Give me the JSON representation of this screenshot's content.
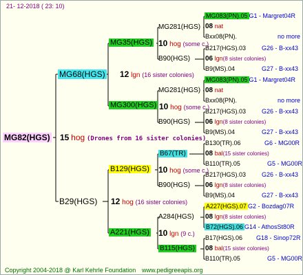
{
  "date": "21- 12-2018 ( 23: 10)",
  "copyright": "Copyright 2004-2018 @ Karl Kehrle Foundation",
  "website": "www.pedigreeapis.org",
  "root": {
    "code": "MG82(HGS)",
    "num": "15",
    "hog": "hog",
    "note": "(Drones from 16 sister colonies)"
  },
  "g1": [
    {
      "code": "MG68(HGS)",
      "num": "12",
      "hog": "lgn",
      "note": "(16 sister colonies)"
    },
    {
      "code": "B29(HGS)",
      "num": "12",
      "hog": "hog",
      "note": "(16 sister colonies)"
    }
  ],
  "g2": [
    {
      "code": "MG35(HGS)",
      "num": "10",
      "hog": "hog",
      "note": "(some c.)"
    },
    {
      "code": "MG300(HGS)",
      "num": "10",
      "hog": "hog",
      "note": "(some c.)"
    },
    {
      "code": "B129(HGS)",
      "num": "10",
      "hog": "hog",
      "note": "(some c.)"
    },
    {
      "code": "A221(HGS)",
      "num": "10",
      "hog": "lgn",
      "note": "(9 c.)"
    }
  ],
  "g3": [
    {
      "code": "MG281(HGS)"
    },
    {
      "code": "B90(HGS)"
    },
    {
      "code": "MG281(HGS)"
    },
    {
      "code": "B90(HGS)"
    },
    {
      "code": "B67(TR)"
    },
    {
      "code": "B90(HGS)"
    },
    {
      "code": "A284(HGS)"
    },
    {
      "code": "B115(HGS)"
    }
  ],
  "g4": [
    {
      "code": "MG083(PN).05",
      "ref": "G1 - Margret04R"
    },
    {
      "line": "08 nat",
      "num": "08",
      "hog": "nat",
      "note": ""
    },
    {
      "code": "Bxx08(PN).",
      "ref": "no more"
    },
    {
      "code": "B217(HGS).03",
      "ref": "G26 - B-xx43"
    },
    {
      "line": "06 lgn(8 sister colonies)",
      "num": "06",
      "hog": "lgn",
      "note": "(8 sister colonies)"
    },
    {
      "code": "B9(MS).04",
      "ref": "G27 - B-xx43"
    },
    {
      "code": "MG083(PN).05",
      "ref": "G1 - Margret04R"
    },
    {
      "line": "08 nat",
      "num": "08",
      "hog": "nat",
      "note": ""
    },
    {
      "code": "Bxx08(PN).",
      "ref": "no more"
    },
    {
      "code": "B217(HGS).03",
      "ref": "G26 - B-xx43"
    },
    {
      "line": "06 lgn(8 sister colonies)",
      "num": "06",
      "hog": "lgn",
      "note": "(8 sister colonies)"
    },
    {
      "code": "B9(MS).04",
      "ref": "G27 - B-xx43"
    },
    {
      "code": "B130(TR).06",
      "ref": "G6 - MG00R"
    },
    {
      "line": "08 bal(15 sister colonies)",
      "num": "08",
      "hog": "bal",
      "note": "(15 sister colonies)"
    },
    {
      "code": "B110(TR).05",
      "ref": "G5 - MG00R"
    },
    {
      "code": "B217(HGS).03",
      "ref": "G26 - B-xx43"
    },
    {
      "line": "06 lgn(8 sister colonies)",
      "num": "06",
      "hog": "lgn",
      "note": "(8 sister colonies)"
    },
    {
      "code": "B9(MS).04",
      "ref": "G27 - B-xx43"
    },
    {
      "code": "A227(HGS).07",
      "ref": "G2 - Bozdag07R"
    },
    {
      "line": "08 lgn(8 sister colonies)",
      "num": "08",
      "hog": "lgn",
      "note": "(8 sister colonies)"
    },
    {
      "code": "B72(HGS).06",
      "ref": "G14 - AthosSt80R"
    },
    {
      "code": "B17(HGS).06",
      "ref": "G18 - Sinop72R"
    },
    {
      "line": "08 bal(15 sister colonies)",
      "num": "08",
      "hog": "bal",
      "note": "(15 sister colonies)"
    },
    {
      "code": "B110(TR).05",
      "ref": "G5 - MG00R"
    }
  ]
}
